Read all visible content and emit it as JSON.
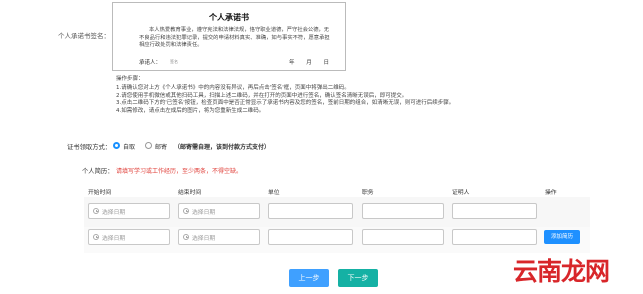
{
  "signature": {
    "label": "个人承诺书签名：",
    "title": "个人承诺书",
    "body": "本人热爱教育事业，遵守宪法和法律法规，恪守职业道德，严守社会公德，无不良品行和违法犯罪记录，提交的申请材料真实、准确，如与事实不符，愿意承担相应行政处罚和法律责任。",
    "signer_label": "承诺人：",
    "signer_name": "签名",
    "date_text": "年 月 日"
  },
  "steps": {
    "title": "操作步骤：",
    "items": [
      "1.请确认您对上方《个人承诺书》中的内容没有异议，再后点击'签名'框，页面中将弹出二维码。",
      "2.请您使用手机微信或其他扫码工具，扫描上述二维码，并在打开的页面中进行签名，确认签名清晰无误后，即可提交。",
      "3.点击二维码下方的'已签名'按钮，检查页面中是否正常显示了承诺书内容及您的签名，签前日期的组合，如清晰无误，则可进行后续步骤。",
      "4.如需修改，请点击左成后的图片，将为您重新生成二维码。"
    ]
  },
  "receive_method": {
    "label": "证书领取方式：",
    "options": [
      "自取",
      "邮寄"
    ],
    "selected": "自取",
    "note": "（邮寄需自理，该到付款方式支付）"
  },
  "resume": {
    "label": "个人简历：",
    "note": "请填写学习或工作经历，至少两条，不得空缺。",
    "headers": [
      "开始时间",
      "结束时间",
      "单位",
      "职务",
      "证明人",
      "操作"
    ],
    "date_placeholder": "选择日期",
    "add_label": "添加简历"
  },
  "buttons": {
    "prev": "上一步",
    "next": "下一步"
  },
  "watermark": "云南龙网"
}
